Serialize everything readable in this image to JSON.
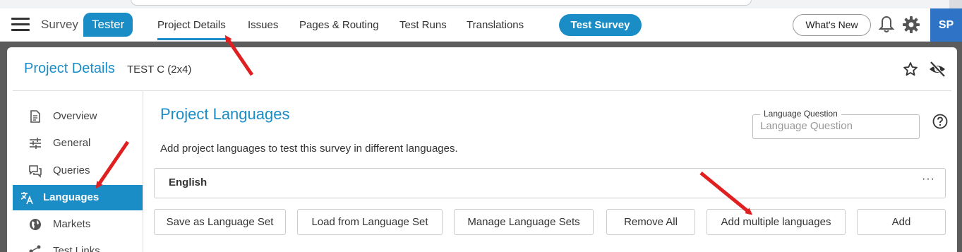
{
  "header": {
    "logo_survey": "Survey",
    "logo_tester": "Tester",
    "tabs": [
      {
        "label": "Project Details"
      },
      {
        "label": "Issues"
      },
      {
        "label": "Pages & Routing"
      },
      {
        "label": "Test Runs"
      },
      {
        "label": "Translations"
      }
    ],
    "test_survey_label": "Test Survey",
    "whats_new_label": "What's New",
    "avatar_initials": "SP"
  },
  "card": {
    "title": "Project Details",
    "subtitle": "TEST C (2x4)"
  },
  "sidebar": {
    "items": [
      {
        "label": "Overview",
        "icon": "document-icon"
      },
      {
        "label": "General",
        "icon": "sliders-icon"
      },
      {
        "label": "Queries",
        "icon": "chat-icon"
      },
      {
        "label": "Languages",
        "icon": "translate-icon"
      },
      {
        "label": "Markets",
        "icon": "globe-icon"
      },
      {
        "label": "Test Links",
        "icon": "share-icon"
      }
    ]
  },
  "content": {
    "title": "Project Languages",
    "description": "Add project languages to test this survey in different languages.",
    "language_question": {
      "label": "Language Question",
      "placeholder": "Language Question"
    },
    "languages": [
      {
        "name": "English"
      }
    ],
    "more_label": "···",
    "actions": [
      {
        "label": "Save as Language Set"
      },
      {
        "label": "Load from Language Set"
      },
      {
        "label": "Manage Language Sets"
      },
      {
        "label": "Remove All"
      },
      {
        "label": "Add multiple languages"
      },
      {
        "label": "Add"
      }
    ]
  },
  "colors": {
    "accent": "#1a8dc6",
    "avatar": "#2f73c7",
    "annotation": "#e02020"
  }
}
